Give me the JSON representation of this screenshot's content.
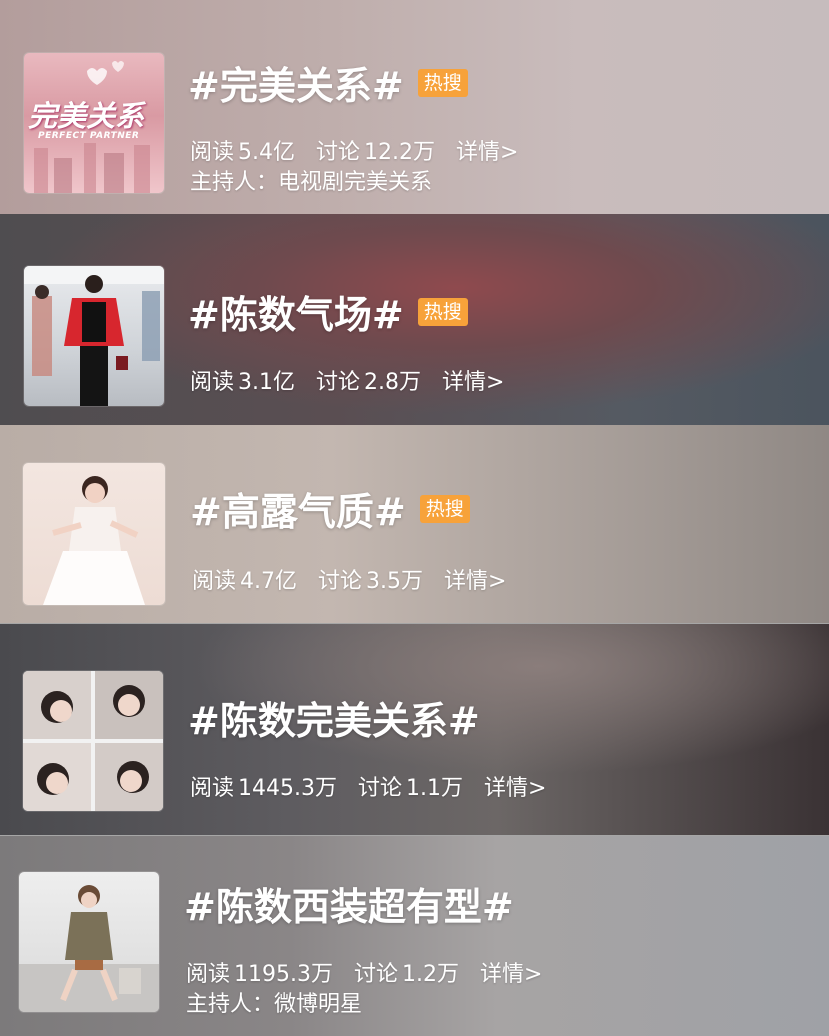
{
  "topics": [
    {
      "title": "#完美关系#",
      "badge": "热搜",
      "read_label": "阅读",
      "read_value": "5.4亿",
      "discuss_label": "讨论",
      "discuss_value": "12.2万",
      "detail": "详情>",
      "host_label": "主持人：",
      "host_value": "电视剧完美关系",
      "thumb_text": "完美关系",
      "thumb_subtext": "PERFECT PARTNER"
    },
    {
      "title": "#陈数气场#",
      "badge": "热搜",
      "read_label": "阅读",
      "read_value": "3.1亿",
      "discuss_label": "讨论",
      "discuss_value": "2.8万",
      "detail": "详情>"
    },
    {
      "title": "#高露气质#",
      "badge": "热搜",
      "read_label": "阅读",
      "read_value": "4.7亿",
      "discuss_label": "讨论",
      "discuss_value": "3.5万",
      "detail": "详情>"
    },
    {
      "title": "#陈数完美关系#",
      "read_label": "阅读",
      "read_value": "1445.3万",
      "discuss_label": "讨论",
      "discuss_value": "1.1万",
      "detail": "详情>"
    },
    {
      "title": "#陈数西装超有型#",
      "read_label": "阅读",
      "read_value": "1195.3万",
      "discuss_label": "讨论",
      "discuss_value": "1.2万",
      "detail": "详情>",
      "host_label": "主持人：",
      "host_value": "微博明星"
    }
  ],
  "colors": {
    "badge": "#f7a23a",
    "text": "#ffffff"
  }
}
